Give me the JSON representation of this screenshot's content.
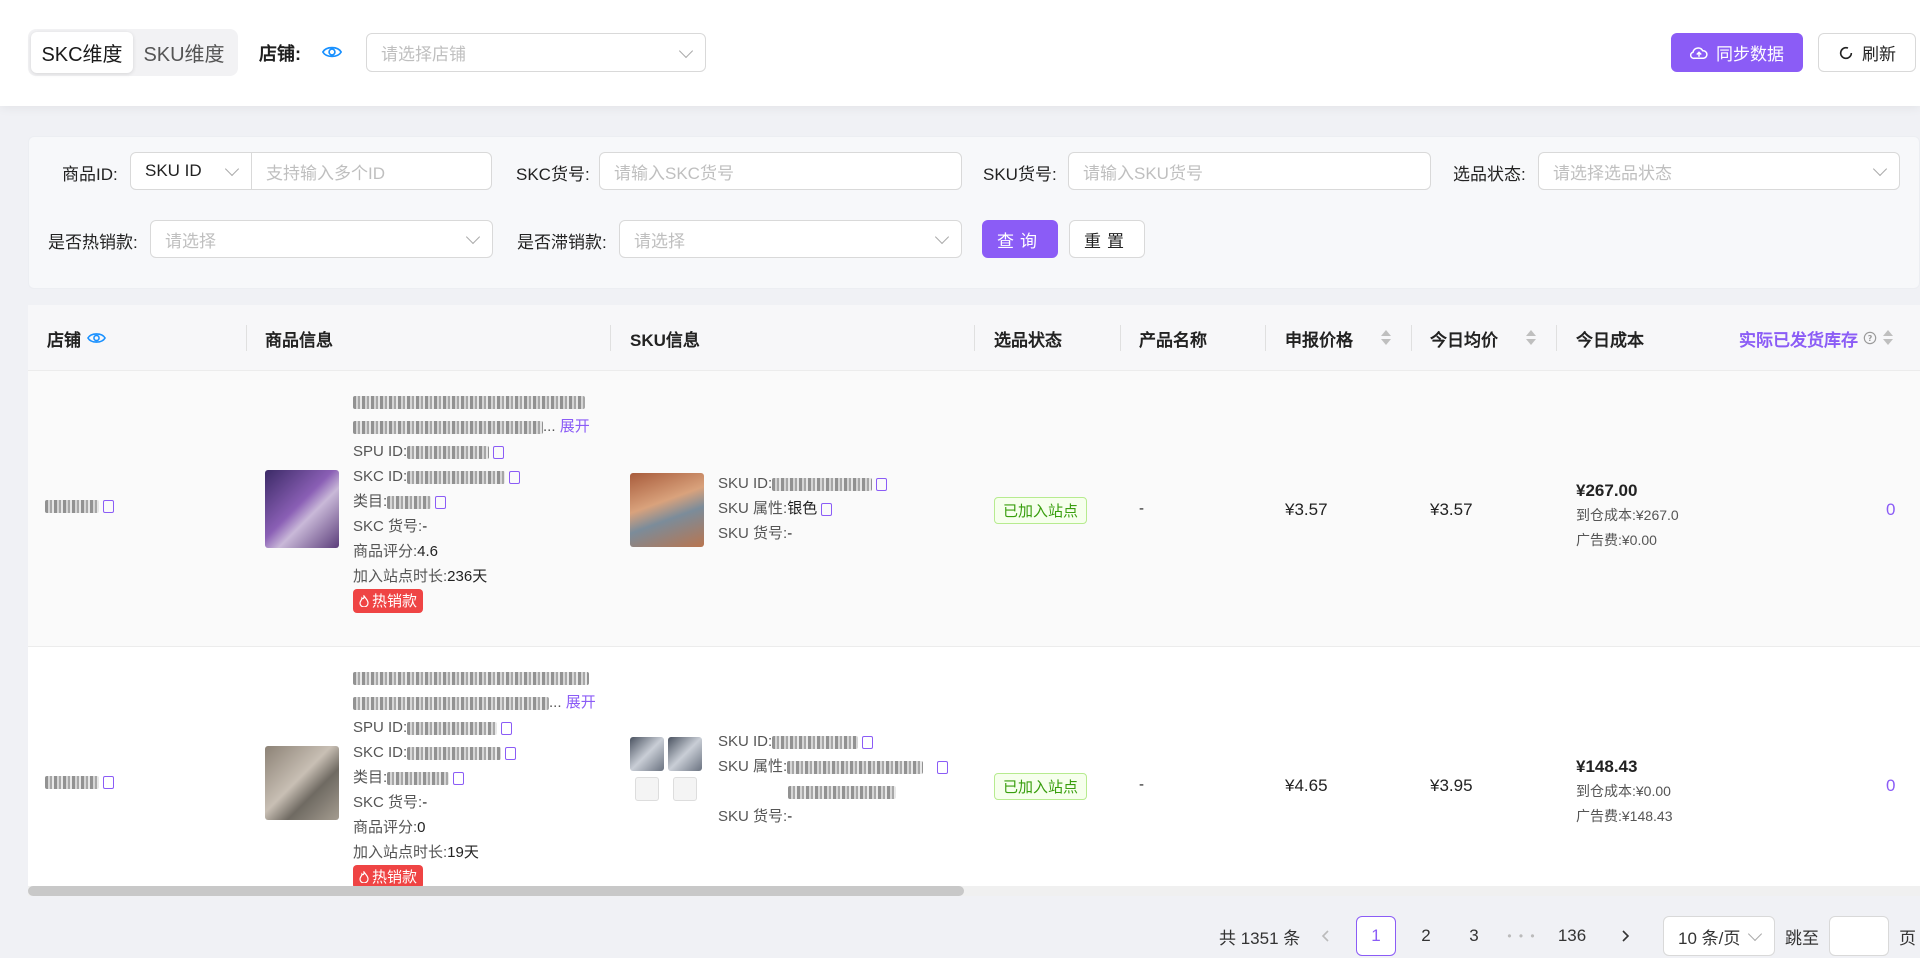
{
  "topbar": {
    "segments": [
      "SKC维度",
      "SKU维度"
    ],
    "store_label": "店铺:",
    "store_placeholder": "请选择店铺",
    "sync_label": "同步数据",
    "refresh_label": "刷新"
  },
  "filter": {
    "product_id_label": "商品ID:",
    "product_id_type": "SKU ID",
    "product_id_placeholder": "支持输入多个ID",
    "skc_code_label": "SKC货号:",
    "skc_code_placeholder": "请输入SKC货号",
    "sku_code_label": "SKU货号:",
    "sku_code_placeholder": "请输入SKU货号",
    "selection_status_label": "选品状态:",
    "selection_status_placeholder": "请选择选品状态",
    "hot_label": "是否热销款:",
    "hot_placeholder": "请选择",
    "slow_label": "是否滞销款:",
    "slow_placeholder": "请选择",
    "query_label": "查询",
    "reset_label": "重置"
  },
  "table": {
    "columns": [
      "店铺",
      "商品信息",
      "SKU信息",
      "选品状态",
      "产品名称",
      "申报价格",
      "今日均价",
      "今日成本",
      "实际已发货库存"
    ],
    "rows": [
      {
        "expand": "展开",
        "spu_label": "SPU ID:",
        "skc_label": "SKC ID:",
        "category_label": "类目:",
        "skc_code_label": "SKC 货号:",
        "skc_code": "-",
        "rating_label": "商品评分:",
        "rating": "4.6",
        "duration_label": "加入站点时长:",
        "duration": "236天",
        "hot_tag": "热销款",
        "sku_id_label": "SKU ID:",
        "sku_attr_label": "SKU 属性:",
        "sku_attr": "银色",
        "sku_code_label": "SKU 货号:",
        "sku_code": "-",
        "status": "已加入站点",
        "product_name": "-",
        "declared_price": "¥3.57",
        "today_avg": "¥3.57",
        "cost_total": "¥267.00",
        "cost_warehouse": "到仓成本:¥267.0",
        "cost_ads": "广告费:¥0.00",
        "shipped_stock": "0"
      },
      {
        "expand": "展开",
        "spu_label": "SPU ID:",
        "skc_label": "SKC ID:",
        "category_label": "类目:",
        "skc_code_label": "SKC 货号:",
        "skc_code": "-",
        "rating_label": "商品评分:",
        "rating": "0",
        "duration_label": "加入站点时长:",
        "duration": "19天",
        "hot_tag": "热销款",
        "sku_id_label": "SKU ID:",
        "sku_attr_label": "SKU 属性:",
        "sku_code_label": "SKU 货号:",
        "sku_code": "-",
        "status": "已加入站点",
        "product_name": "-",
        "declared_price": "¥4.65",
        "today_avg": "¥3.95",
        "cost_total": "¥148.43",
        "cost_warehouse": "到仓成本:¥0.00",
        "cost_ads": "广告费:¥148.43",
        "shipped_stock": "0"
      }
    ]
  },
  "pagination": {
    "total": "共 1351 条",
    "pages": [
      "1",
      "2",
      "3",
      "136"
    ],
    "ellipsis": "• • •",
    "page_size": "10 条/页",
    "jump_label": "跳至",
    "page_suffix": "页"
  },
  "colors": {
    "accent": "#8b5cf6",
    "hot": "#ef4444",
    "status_green": "#389e0d"
  }
}
